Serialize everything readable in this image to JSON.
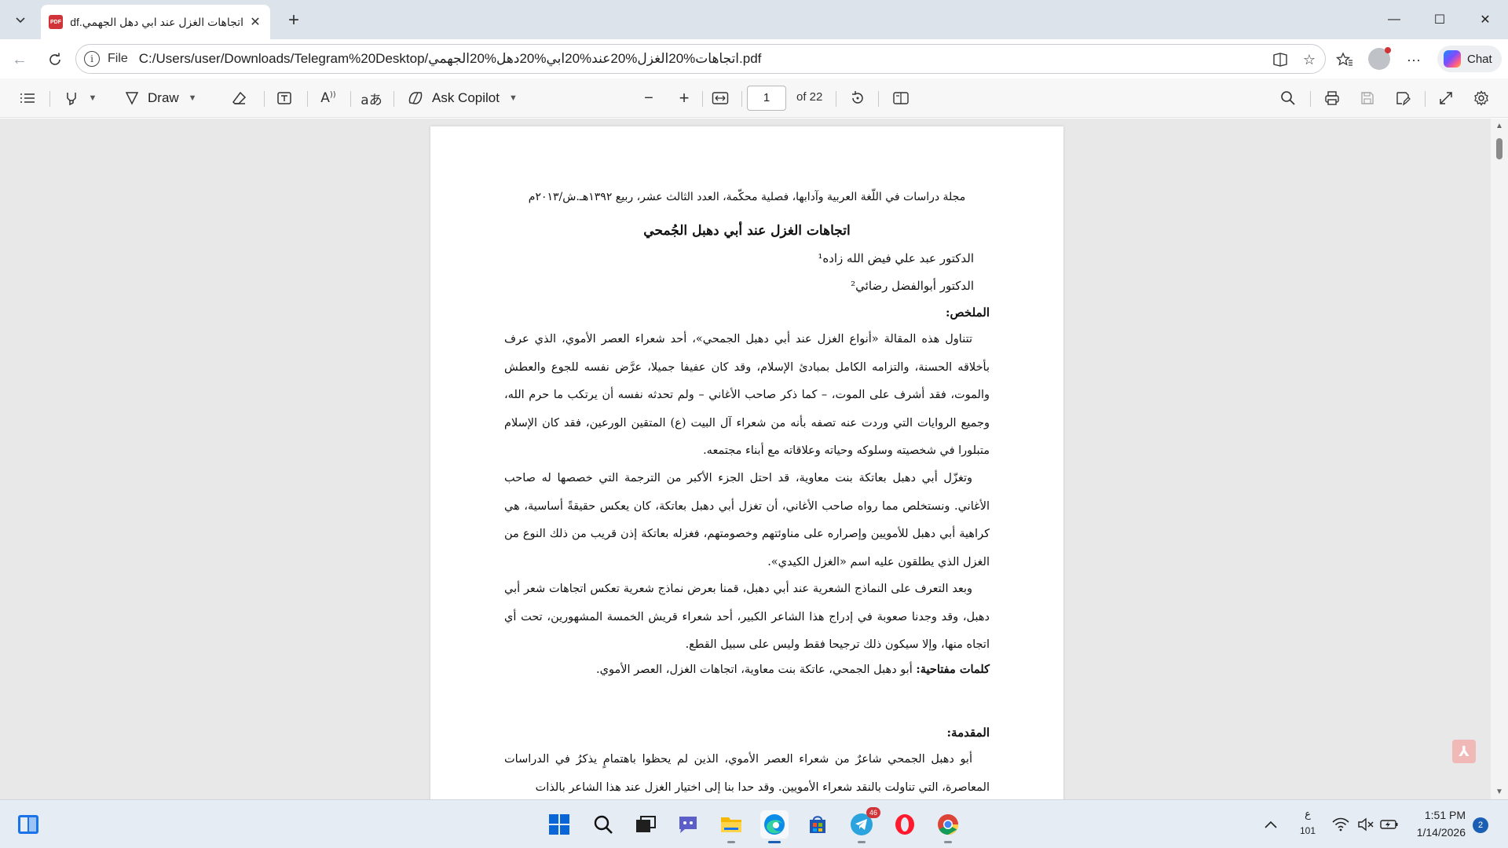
{
  "browser": {
    "tab": {
      "title": "اتجاهات الغزل عند ابي دهل الجهمي.pdf",
      "favicon": "PDF"
    },
    "window_controls": {
      "minimize": "—",
      "maximize": "☐",
      "close": "✕"
    },
    "address": {
      "scheme": "File",
      "url": "C:/Users/user/Downloads/Telegram%20Desktop/اتجاهات%20الغزل%20عند%20ابي%20دهل%20الجهمي.pdf"
    },
    "chat_label": "Chat"
  },
  "pdf_toolbar": {
    "draw_label": "Draw",
    "ask_copilot_label": "Ask Copilot",
    "page_number": "1",
    "page_count": "of 22"
  },
  "document": {
    "journal_line": "مجلة دراسات في اللّغة العربية وآدابها، فصلية محكّمة، العدد الثالث عشر، ربيع ١٣٩٢هـ.ش/٢٠١٣م",
    "title": "اتجاهات الغزل عند أبي دهبل الجُمحي",
    "author1": "الدكتور عبد علي فيض الله زاده¹",
    "author2": "الدكتور أبوالفضل رضائي²",
    "abstract_heading": "الملخص:",
    "abstract_p1": "تتناول هذه المقالة «أنواع الغزل عند أبي دهبل الجمحي»، أحد شعراء العصر الأموي، الذي عرف بأخلاقه الحسنة، والتزامه الكامل بمبادئ الإسلام، وقد كان عفيفا جميلا، عرَّض نفسه للجوع والعطش والموت، فقد أشرف على الموت، – كما ذكر صاحب الأغاني – ولم تحدثه نفسه أن يرتكب ما حرم الله، وجميع الروايات التي وردت عنه تصفه بأنه من شعراء آل البيت (ع) المتقين الورعين، فقد كان الإسلام متبلورا في شخصيته وسلوكه وحياته وعلاقاته مع أبناء مجتمعه.",
    "abstract_p2": "وتغزّل أبي دهبل بعاتكة بنت معاوية، قد احتل الجزء الأكبر من الترجمة التي خصصها له صاحب الأغاني. ونستخلص مما رواه صاحب الأغاني، أن تغزل أبي دهبل بعاتكة، كان يعكس حقيقةً أساسية، هي كراهية أبي دهبل للأمويين وإصراره على مناوئتهم وخصومتهم، فغزله بعاتكة إذن قريب من ذلك النوع من الغزل الذي يطلقون عليه اسم «الغزل الكيدي».",
    "abstract_p3": "وبعد التعرف على النماذج الشعرية عند أبي دهبل، قمنا بعرض نماذج شعرية تعكس اتجاهات شعر أبي دهبل، وقد وجدنا صعوبة في إدراج هذا الشاعر الكبير، أحد شعراء قريش الخمسة المشهورين، تحت أي اتجاه منها، وإلا سيكون ذلك ترجيحا فقط وليس على سبيل القطع.",
    "keywords_label": "كلمات مفتاحية:",
    "keywords": " أبو دهبل الجمحي، عاتكة بنت معاوية، اتجاهات الغزل، العصر الأموي.",
    "intro_heading": "المقدمة:",
    "intro_p1": "أبو دهبل الجمحي شاعرٌ من شعراء العصر الأموي، الذين لم يحظوا باهتمامٍ يذكرُ في الدراسات المعاصرة، التي تناولت بالنقد شعراء الأمويين. وقد حدا بنا إلى اختيار الغزل عند هذا الشاعر بالذات"
  },
  "taskbar": {
    "telegram_badge": "46",
    "lang_indicator": "ع",
    "lang_sub": "101",
    "time": "1:51 PM",
    "date": "1/14/2026",
    "notification_count": "2"
  },
  "colors": {
    "tabbar_bg": "#dde3ea",
    "viewer_bg": "#e8e8e8",
    "taskbar_bg": "#e6ecf4",
    "pdf_red": "#d13438"
  }
}
